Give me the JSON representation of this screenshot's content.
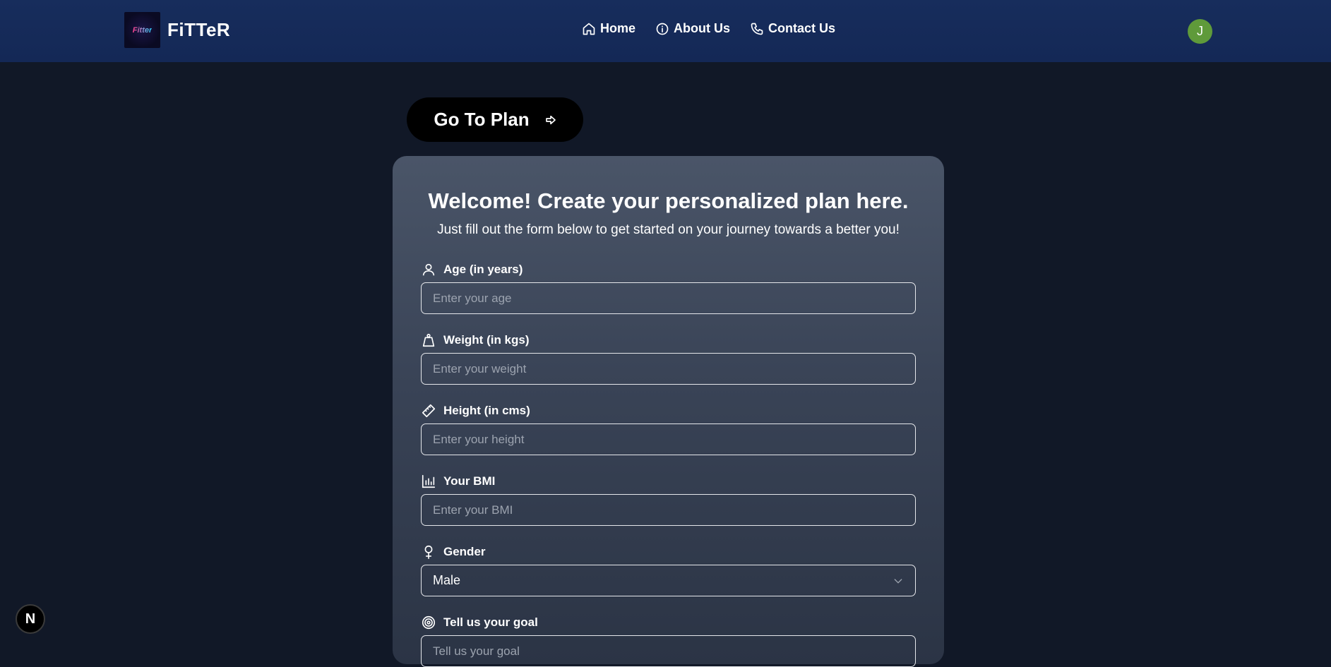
{
  "navbar": {
    "logo_text": "Fitter",
    "brand": "FiTTeR",
    "links": [
      {
        "label": "Home",
        "icon": "home-icon"
      },
      {
        "label": "About Us",
        "icon": "info-icon"
      },
      {
        "label": "Contact Us",
        "icon": "phone-icon"
      }
    ],
    "avatar_initial": "J"
  },
  "go_to_plan": {
    "label": "Go To Plan",
    "icon": "arrow-right-icon"
  },
  "form": {
    "title": "Welcome! Create your personalized plan here.",
    "subtitle": "Just fill out the form below to get started on your journey towards a better you!",
    "fields": [
      {
        "label": "Age (in years)",
        "placeholder": "Enter your age",
        "icon": "user-icon"
      },
      {
        "label": "Weight (in kgs)",
        "placeholder": "Enter your weight",
        "icon": "weight-icon"
      },
      {
        "label": "Height (in cms)",
        "placeholder": "Enter your height",
        "icon": "ruler-icon"
      },
      {
        "label": "Your BMI",
        "placeholder": "Enter your BMI",
        "icon": "bar-chart-icon"
      }
    ],
    "gender": {
      "label": "Gender",
      "value": "Male",
      "icon": "female-icon"
    },
    "goal": {
      "label": "Tell us your goal",
      "placeholder": "Tell us your goal",
      "icon": "target-icon"
    }
  },
  "corner_badge": "N"
}
